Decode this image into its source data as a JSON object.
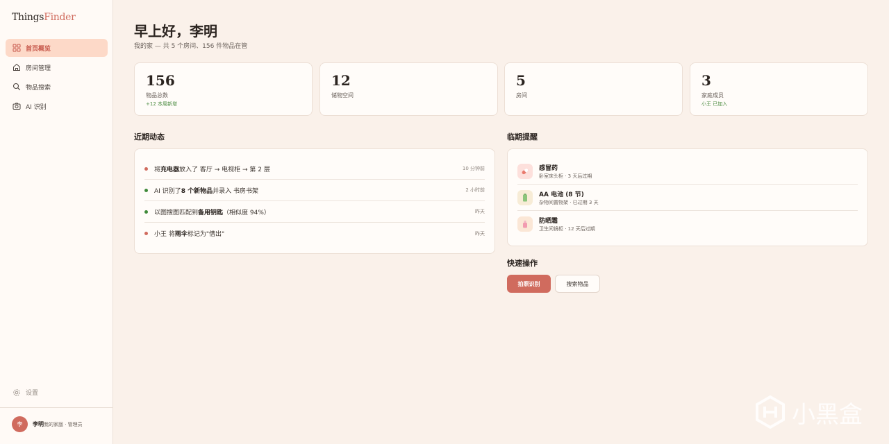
{
  "app": {
    "logo_part1": "Things",
    "logo_part2": "Finder"
  },
  "sidebar": {
    "items": [
      {
        "label": "首页概览",
        "icon": "grid-icon",
        "active": true
      },
      {
        "label": "房间管理",
        "icon": "home-icon",
        "active": false
      },
      {
        "label": "物品搜索",
        "icon": "search-icon",
        "active": false
      },
      {
        "label": "AI 识别",
        "icon": "camera-icon",
        "active": false
      }
    ],
    "settings_label": "设置",
    "user": {
      "avatar_text": "李",
      "name": "李明",
      "role": "我的家庭 · 管理员"
    }
  },
  "header": {
    "greeting": "早上好，李明",
    "subtitle": "我的家 — 共 5 个房间、156 件物品在管"
  },
  "stats": [
    {
      "value": "156",
      "label": "物品总数",
      "extra": "+12 本周新增"
    },
    {
      "value": "12",
      "label": "储物空间",
      "extra": ""
    },
    {
      "value": "5",
      "label": "房间",
      "extra": ""
    },
    {
      "value": "3",
      "label": "家庭成员",
      "extra": "小王 已加入"
    }
  ],
  "activity": {
    "title": "近期动态",
    "items": [
      {
        "pre": "将 ",
        "bold": "充电器",
        "post": " 放入了 客厅 → 电视柜 → 第 2 层",
        "time": "10 分钟前",
        "color": "#d06b5e"
      },
      {
        "pre": "AI 识别了 ",
        "bold": "8 个新物品",
        "post": " 并录入 书房书架",
        "time": "2 小时前",
        "color": "#3f8a3a"
      },
      {
        "pre": "以图搜图匹配到 ",
        "bold": "备用钥匙",
        "post": "（相似度 94%）",
        "time": "昨天",
        "color": "#3f8a3a"
      },
      {
        "pre": "小王 将 ",
        "bold": "雨伞",
        "post": " 标记为\"借出\"",
        "time": "昨天",
        "color": "#d06b5e"
      }
    ]
  },
  "expiry": {
    "title": "临期提醒",
    "items": [
      {
        "name": "感冒药",
        "detail": "卧室床头柜 · 3 天后过期",
        "icon": "pill-icon",
        "bg": "#fde0dc"
      },
      {
        "name": "AA 电池 (8 节)",
        "detail": "杂物间置物架 · 已过期 3 天",
        "icon": "battery-icon",
        "bg": "#f7ecd6"
      },
      {
        "name": "防晒霜",
        "detail": "卫生间镜柜 · 12 天后过期",
        "icon": "bottle-icon",
        "bg": "#fbe7d6"
      }
    ]
  },
  "quick": {
    "title": "快速操作",
    "primary_label": "拍照识别",
    "secondary_label": "搜索物品"
  },
  "watermark": {
    "text": "小黑盒"
  }
}
